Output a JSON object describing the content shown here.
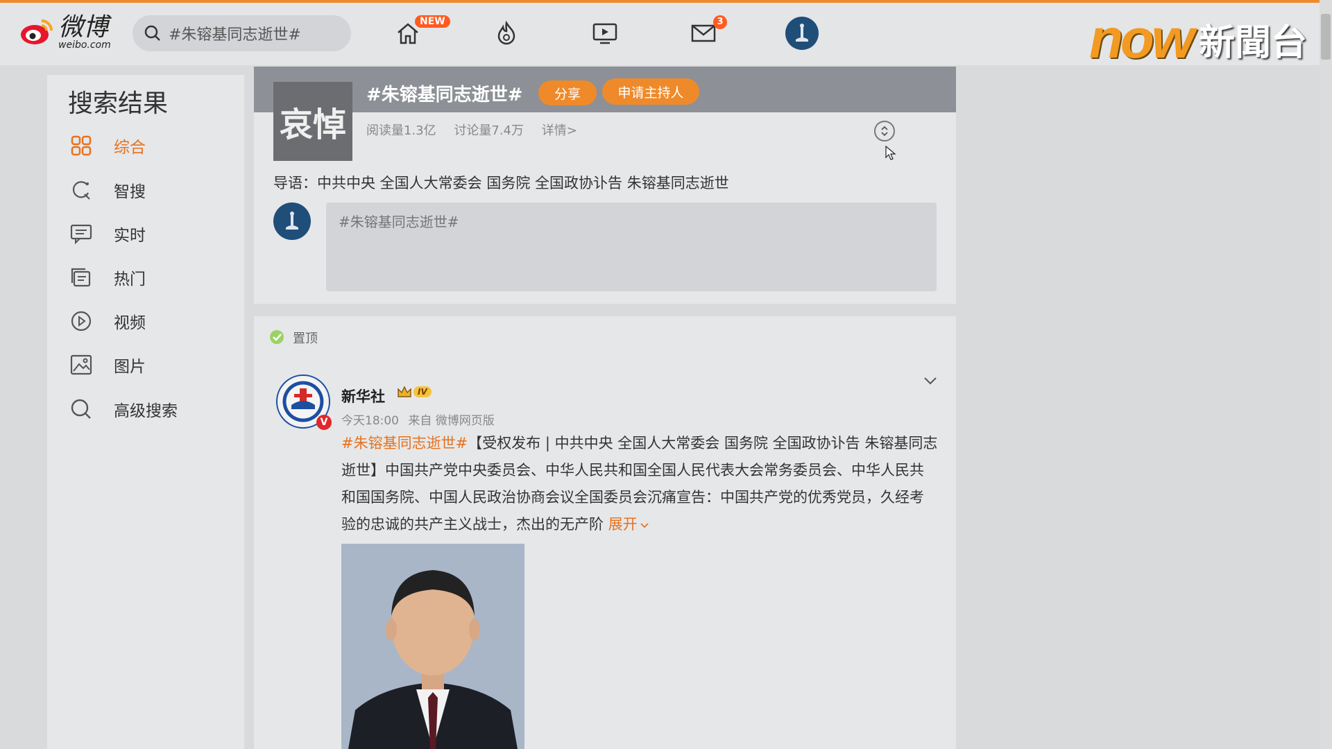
{
  "header": {
    "logo_main": "微博",
    "logo_sub": "weibo.com",
    "search_value": "#朱镕基同志逝世#",
    "home_badge": "NEW",
    "mail_badge": "3"
  },
  "watermark": {
    "brand": "now",
    "channel": "新聞台"
  },
  "sidebar": {
    "title": "搜索结果",
    "items": [
      {
        "label": "综合",
        "icon": "grid-icon",
        "active": true
      },
      {
        "label": "智搜",
        "icon": "smart-search-icon"
      },
      {
        "label": "实时",
        "icon": "realtime-icon"
      },
      {
        "label": "热门",
        "icon": "hot-icon"
      },
      {
        "label": "视频",
        "icon": "video-icon"
      },
      {
        "label": "图片",
        "icon": "image-icon"
      },
      {
        "label": "高级搜索",
        "icon": "advanced-search-icon"
      }
    ]
  },
  "topic": {
    "thumb_text": "哀悼",
    "title": "#朱镕基同志逝世#",
    "share_label": "分享",
    "host_label": "申请主持人",
    "reads": "阅读量1.3亿",
    "discussions": "讨论量7.4万",
    "details": "详情>",
    "intro": "导语：中共中央 全国人大常委会 国务院 全国政协讣告 朱镕基同志逝世",
    "composer_placeholder": "#朱镕基同志逝世#"
  },
  "post": {
    "pinned_label": "置顶",
    "author": "新华社",
    "vip_level": "IV",
    "time": "今天18:00",
    "source": "来自 微博网页版",
    "hashtag": "#朱镕基同志逝世#",
    "body": "【受权发布 | 中共中央 全国人大常委会 国务院 全国政协讣告 朱镕基同志逝世】中国共产党中央委员会、中华人民共和国全国人民代表大会常务委员会、中华人民共和国国务院、中国人民政治协商会议全国委员会沉痛宣告：中国共产党的优秀党员，久经考验的忠诚的共产主义战士，杰出的无产阶 ",
    "expand_label": "展开"
  },
  "colors": {
    "accent": "#ef8a2a",
    "link": "#e6721d",
    "topline": "#f08a2c"
  }
}
